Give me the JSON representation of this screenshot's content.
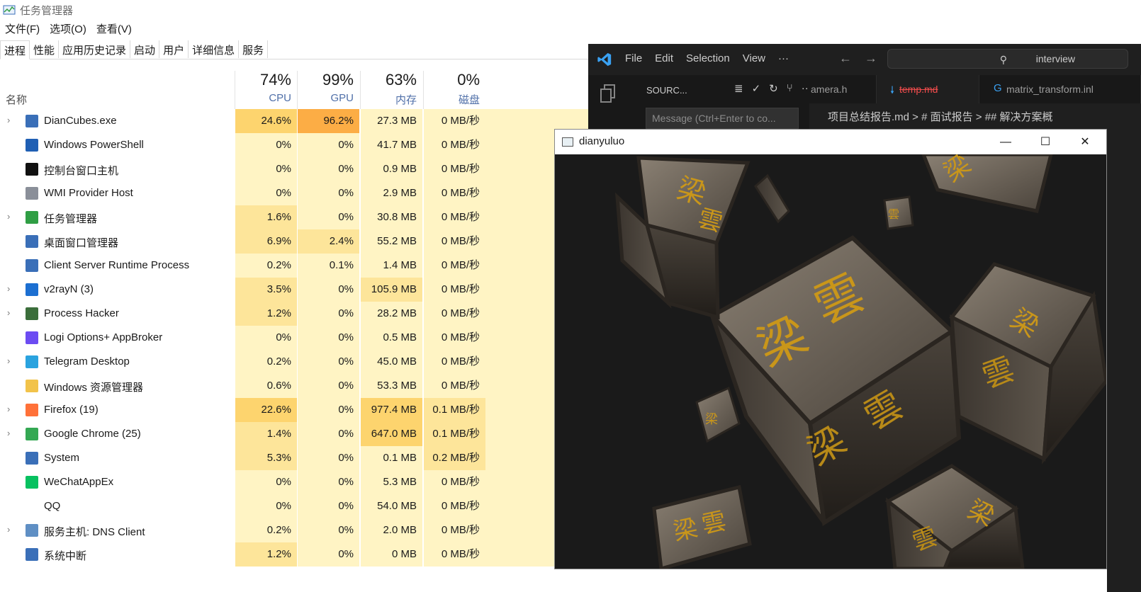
{
  "task_manager": {
    "title": "任务管理器",
    "menu": [
      "文件(F)",
      "选项(O)",
      "查看(V)"
    ],
    "tabs": [
      "进程",
      "性能",
      "应用历史记录",
      "启动",
      "用户",
      "详细信息",
      "服务"
    ],
    "columns": {
      "name": "名称",
      "cpu": {
        "pct": "74%",
        "label": "CPU"
      },
      "gpu": {
        "pct": "99%",
        "label": "GPU"
      },
      "mem": {
        "pct": "63%",
        "label": "内存"
      },
      "disk": {
        "pct": "0%",
        "label": "磁盘"
      }
    },
    "processes": [
      {
        "name": "DianCubes.exe",
        "expand": true,
        "icon": "app-window-icon",
        "cpu": "24.6%",
        "gpu": "96.2%",
        "mem": "27.3 MB",
        "disk": "0 MB/秒"
      },
      {
        "name": "Windows PowerShell",
        "expand": false,
        "icon": "powershell-icon",
        "cpu": "0%",
        "gpu": "0%",
        "mem": "41.7 MB",
        "disk": "0 MB/秒"
      },
      {
        "name": "控制台窗口主机",
        "expand": false,
        "icon": "console-icon",
        "cpu": "0%",
        "gpu": "0%",
        "mem": "0.9 MB",
        "disk": "0 MB/秒"
      },
      {
        "name": "WMI Provider Host",
        "expand": false,
        "icon": "wmi-icon",
        "cpu": "0%",
        "gpu": "0%",
        "mem": "2.9 MB",
        "disk": "0 MB/秒"
      },
      {
        "name": "任务管理器",
        "expand": true,
        "icon": "task-manager-icon",
        "cpu": "1.6%",
        "gpu": "0%",
        "mem": "30.8 MB",
        "disk": "0 MB/秒"
      },
      {
        "name": "桌面窗口管理器",
        "expand": false,
        "icon": "app-window-icon",
        "cpu": "6.9%",
        "gpu": "2.4%",
        "mem": "55.2 MB",
        "disk": "0 MB/秒"
      },
      {
        "name": "Client Server Runtime Process",
        "expand": false,
        "icon": "app-window-icon",
        "cpu": "0.2%",
        "gpu": "0.1%",
        "mem": "1.4 MB",
        "disk": "0 MB/秒"
      },
      {
        "name": "v2rayN (3)",
        "expand": true,
        "icon": "v2rayn-icon",
        "cpu": "3.5%",
        "gpu": "0%",
        "mem": "105.9 MB",
        "disk": "0 MB/秒"
      },
      {
        "name": "Process Hacker",
        "expand": true,
        "icon": "process-hacker-icon",
        "cpu": "1.2%",
        "gpu": "0%",
        "mem": "28.2 MB",
        "disk": "0 MB/秒"
      },
      {
        "name": "Logi Options+ AppBroker",
        "expand": false,
        "icon": "logi-icon",
        "cpu": "0%",
        "gpu": "0%",
        "mem": "0.5 MB",
        "disk": "0 MB/秒"
      },
      {
        "name": "Telegram Desktop",
        "expand": true,
        "icon": "telegram-icon",
        "cpu": "0.2%",
        "gpu": "0%",
        "mem": "45.0 MB",
        "disk": "0 MB/秒"
      },
      {
        "name": "Windows 资源管理器",
        "expand": false,
        "icon": "explorer-folder-icon",
        "cpu": "0.6%",
        "gpu": "0%",
        "mem": "53.3 MB",
        "disk": "0 MB/秒"
      },
      {
        "name": "Firefox (19)",
        "expand": true,
        "icon": "firefox-icon",
        "cpu": "22.6%",
        "gpu": "0%",
        "mem": "977.4 MB",
        "disk": "0.1 MB/秒"
      },
      {
        "name": "Google Chrome (25)",
        "expand": true,
        "icon": "chrome-icon",
        "cpu": "1.4%",
        "gpu": "0%",
        "mem": "647.0 MB",
        "disk": "0.1 MB/秒"
      },
      {
        "name": "System",
        "expand": false,
        "icon": "app-window-icon",
        "cpu": "5.3%",
        "gpu": "0%",
        "mem": "0.1 MB",
        "disk": "0.2 MB/秒"
      },
      {
        "name": "WeChatAppEx",
        "expand": false,
        "icon": "wechat-icon",
        "cpu": "0%",
        "gpu": "0%",
        "mem": "5.3 MB",
        "disk": "0 MB/秒"
      },
      {
        "name": "QQ",
        "expand": false,
        "icon": "",
        "cpu": "0%",
        "gpu": "0%",
        "mem": "54.0 MB",
        "disk": "0 MB/秒"
      },
      {
        "name": "服务主机: DNS Client",
        "expand": true,
        "icon": "service-gear-icon",
        "cpu": "0.2%",
        "gpu": "0%",
        "mem": "2.0 MB",
        "disk": "0 MB/秒"
      },
      {
        "name": "系统中断",
        "expand": false,
        "icon": "app-window-icon",
        "cpu": "1.2%",
        "gpu": "0%",
        "mem": "0 MB",
        "disk": "0 MB/秒"
      }
    ]
  },
  "vscode": {
    "menu": [
      "File",
      "Edit",
      "Selection",
      "View",
      "···"
    ],
    "search_text": "interview",
    "source_control_title": "SOURC...",
    "commit_placeholder": "Message (Ctrl+Enter to co...",
    "tabs": [
      "amera.h",
      "temp.md",
      "matrix_transform.inl"
    ],
    "breadcrumb": "项目总结报告.md > # 面试报告 > ## 解决方案概"
  },
  "dianyuluo": {
    "title": "dianyuluo",
    "controls": {
      "minimize": "—",
      "maximize": "☐",
      "close": "✕"
    }
  },
  "colors": {
    "heat_low": "#fff4c4",
    "heat_mid": "#fde59a",
    "heat_high": "#fdd46e",
    "heat_max": "#fcad45",
    "vscode_bg": "#1f1f1f",
    "vscode_blue": "#0078d4",
    "cube_gold": "#c9961a"
  }
}
